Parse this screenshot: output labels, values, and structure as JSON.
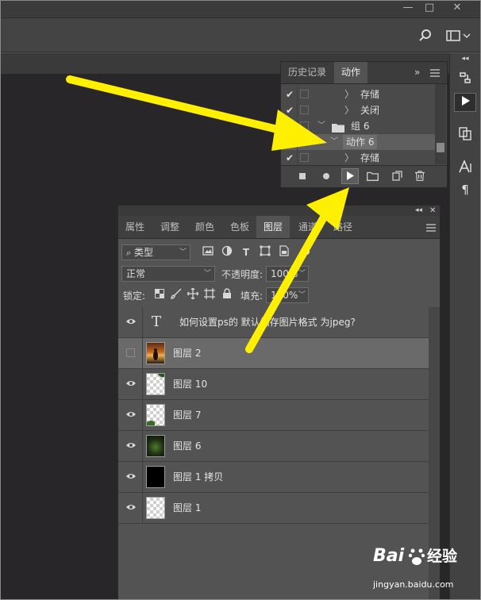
{
  "window": {
    "minimize_label": "—",
    "restore_label": "□",
    "close_label": "✕"
  },
  "actions_panel": {
    "tabs": [
      {
        "label": "历史记录"
      },
      {
        "label": "动作"
      }
    ],
    "collapse_label": "»",
    "rows": [
      {
        "checked": true,
        "expander": "〉",
        "label": "存储"
      },
      {
        "checked": true,
        "expander": "〉",
        "label": "关闭"
      },
      {
        "checked": true,
        "expander": "﹀",
        "label": "组 6"
      },
      {
        "checked": true,
        "expander": "﹀",
        "label": "动作 6"
      },
      {
        "checked": true,
        "expander": "〉",
        "label": "存储"
      }
    ]
  },
  "layers_panel": {
    "tabs": [
      {
        "label": "属性"
      },
      {
        "label": "调整"
      },
      {
        "label": "颜色"
      },
      {
        "label": "色板"
      },
      {
        "label": "图层"
      },
      {
        "label": "通道"
      },
      {
        "label": "路径"
      }
    ],
    "filter_label": "类型",
    "blend_mode": "正常",
    "opacity_label": "不透明度:",
    "opacity_value": "100%",
    "lock_label": "锁定:",
    "fill_label": "填充:",
    "fill_value": "100%",
    "layers": [
      {
        "name": "如何设置ps的 默认储存图片格式 为jpeg?",
        "type": "text",
        "visible": true
      },
      {
        "name": "图层 2",
        "type": "photo-sunset",
        "visible": false
      },
      {
        "name": "图层 10",
        "type": "transparent",
        "visible": true
      },
      {
        "name": "图层 7",
        "type": "transparent",
        "visible": true
      },
      {
        "name": "图层 6",
        "type": "photo-green",
        "visible": true
      },
      {
        "name": "图层 1 拷贝",
        "type": "black",
        "visible": true
      },
      {
        "name": "图层 1",
        "type": "transparent",
        "visible": true
      }
    ]
  },
  "watermark": {
    "brand": "Bai",
    "brand_suffix": "经验",
    "url": "jingyan.baidu.com"
  },
  "colors": {
    "arrow": "#ffef00",
    "panel_bg": "#535353",
    "canvas_bg": "#282628"
  }
}
